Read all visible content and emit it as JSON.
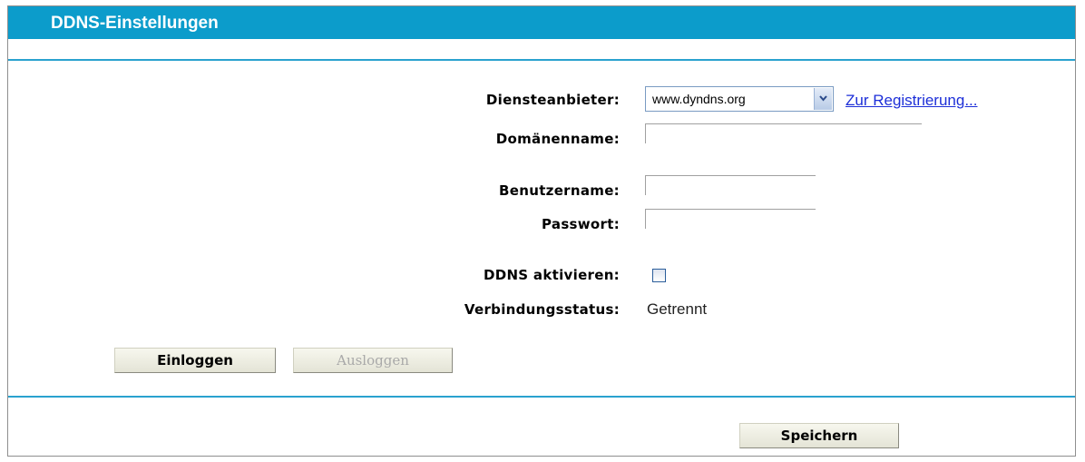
{
  "header": {
    "title": "DDNS-Einstellungen"
  },
  "form": {
    "provider_label": "Diensteanbieter:",
    "provider_value": "www.dyndns.org",
    "register_link": "Zur Registrierung...",
    "domain_label": "Domänenname:",
    "domain_value": "",
    "username_label": "Benutzername:",
    "username_value": "",
    "password_label": "Passwort:",
    "password_value": "",
    "enable_label": "DDNS aktivieren:",
    "enable_checked": false,
    "status_label": "Verbindungsstatus:",
    "status_value": "Getrennt"
  },
  "buttons": {
    "login": "Einloggen",
    "logout": "Ausloggen",
    "save": "Speichern"
  },
  "colors": {
    "header_bg": "#0c9ccb",
    "divider": "#2aa2cf",
    "link": "#1d2fd8"
  },
  "icons": {
    "select_arrow": "chevron-down-icon"
  }
}
